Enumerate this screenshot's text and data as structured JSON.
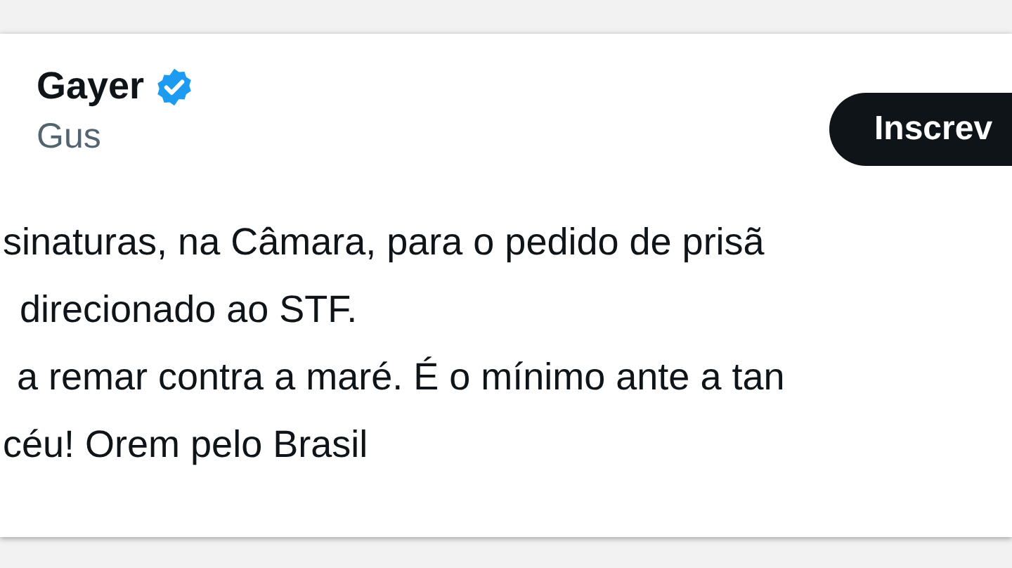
{
  "author": {
    "name": "Gayer",
    "verified": true,
    "handle": "Gus"
  },
  "follow_button": {
    "label": "Inscrev"
  },
  "body_lines": [
    "sinaturas, na Câmara, para o pedido de prisã",
    "direcionado ao STF.",
    "a remar contra a maré. É o mínimo ante a tan",
    "céu! Orem pelo Brasil"
  ]
}
